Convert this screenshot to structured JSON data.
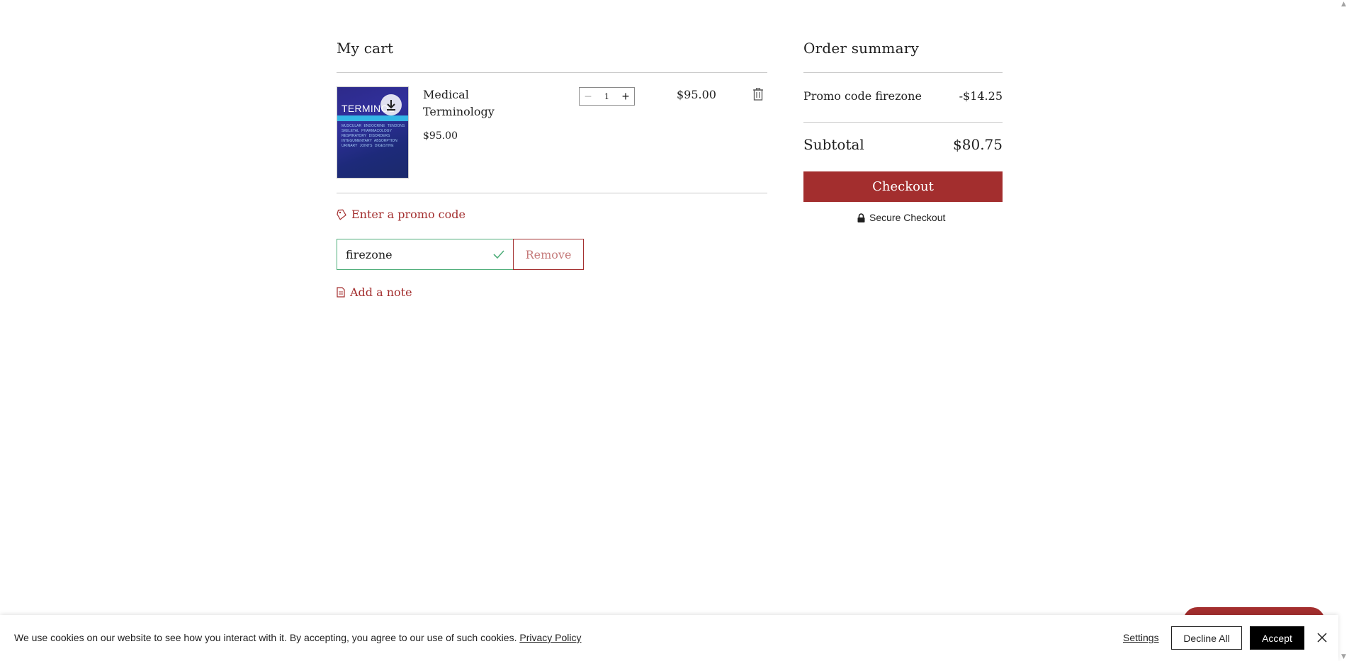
{
  "cart": {
    "title": "My cart",
    "item": {
      "name_line1": "Medical",
      "name_line2": "Terminology",
      "unit_price": "$95.00",
      "quantity": "1",
      "line_total": "$95.00",
      "thumbnail": {
        "cover_title": "TERMINOL",
        "cover_words": "MUSCULAR ENDOCRINE TENDONS SKELETAL PHARMACOLOGY RESPIRATORY DISORDERS INTEGUMENTARY ABSORPTION URINARY JOINTS DIGESTIVE",
        "icon": "download-icon"
      }
    },
    "promo_link": "Enter a promo code",
    "promo_value": "firezone",
    "remove_label": "Remove",
    "note_link": "Add a note"
  },
  "summary": {
    "title": "Order summary",
    "promo_label": "Promo code firezone",
    "promo_amount": "-$14.25",
    "subtotal_label": "Subtotal",
    "subtotal_value": "$80.75",
    "checkout_label": "Checkout",
    "secure_label": "Secure Checkout"
  },
  "cookie": {
    "text": "We use cookies on our website to see how you interact with it. By accepting, you agree to our use of such cookies.",
    "privacy_link": "Privacy Policy",
    "settings": "Settings",
    "decline": "Decline All",
    "accept": "Accept"
  },
  "colors": {
    "accent": "#a32e2e",
    "valid_border": "#4fae7a",
    "divider": "#c9c9c9"
  }
}
